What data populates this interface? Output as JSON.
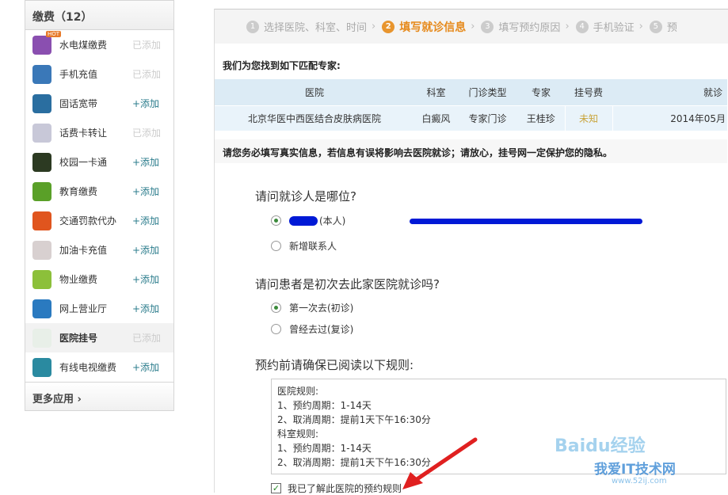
{
  "sidebar": {
    "title": "缴费（12）",
    "more": "更多应用",
    "hot": "HOT",
    "items": [
      {
        "label": "水电煤缴费",
        "action": "已添加",
        "added": true,
        "icon": "utilities-icon",
        "color": "#8a4fb0"
      },
      {
        "label": "手机充值",
        "action": "已添加",
        "added": true,
        "icon": "mobile-phone-icon",
        "color": "#3a78b8"
      },
      {
        "label": "固话宽带",
        "action": "+添加",
        "added": false,
        "icon": "landline-icon",
        "color": "#2a6ea0"
      },
      {
        "label": "话费卡转让",
        "action": "已添加",
        "added": true,
        "icon": "phone-card-icon",
        "color": "#c8c8d8"
      },
      {
        "label": "校园一卡通",
        "action": "+添加",
        "added": false,
        "icon": "campus-card-icon",
        "color": "#2c3a22"
      },
      {
        "label": "教育缴费",
        "action": "+添加",
        "added": false,
        "icon": "education-icon",
        "color": "#5aa028"
      },
      {
        "label": "交通罚款代办",
        "action": "+添加",
        "added": false,
        "icon": "traffic-fine-icon",
        "color": "#e0551e"
      },
      {
        "label": "加油卡充值",
        "action": "+添加",
        "added": false,
        "icon": "fuel-card-icon",
        "color": "#d8d0d0"
      },
      {
        "label": "物业缴费",
        "action": "+添加",
        "added": false,
        "icon": "property-icon",
        "color": "#8cc03a"
      },
      {
        "label": "网上营业厅",
        "action": "+添加",
        "added": false,
        "icon": "online-hall-icon",
        "color": "#2a7ac0"
      },
      {
        "label": "医院挂号",
        "action": "已添加",
        "added": true,
        "active": true,
        "icon": "hospital-icon",
        "color": "#e8efe8"
      },
      {
        "label": "有线电视缴费",
        "action": "+添加",
        "added": false,
        "icon": "tv-icon",
        "color": "#2a8aa0"
      }
    ]
  },
  "steps": [
    {
      "n": "1",
      "label": "选择医院、科室、时间"
    },
    {
      "n": "2",
      "label": "填写就诊信息"
    },
    {
      "n": "3",
      "label": "填写预约原因"
    },
    {
      "n": "4",
      "label": "手机验证"
    },
    {
      "n": "5",
      "label": "预"
    }
  ],
  "found_title": "我们为您找到如下匹配专家:",
  "table": {
    "headers": [
      "医院",
      "科室",
      "门诊类型",
      "专家",
      "挂号费",
      "就诊"
    ],
    "row": [
      "北京华医中西医结合皮肤病医院",
      "白癜风",
      "专家门诊",
      "王桂珍",
      "未知",
      "2014年05月"
    ]
  },
  "warning": "请您务必填写真实信息，若信息有误将影响去医院就诊；请放心，挂号网一定保护您的隐私。",
  "q1": {
    "title": "请问就诊人是哪位?",
    "opt1": "(本人)",
    "opt2": "新增联系人"
  },
  "q2": {
    "title": "请问患者是初次去此家医院就诊吗?",
    "opt1": "第一次去(初诊)",
    "opt2": "曾经去过(复诊)"
  },
  "q3": {
    "title": "预约前请确保已阅读以下规则:"
  },
  "rules": [
    "医院规则:",
    "1、预约周期：1-14天",
    "2、取消周期：提前1天下午16:30分",
    "科室规则:",
    "1、预约周期：1-14天",
    "2、取消周期：提前1天下午16:30分"
  ],
  "agree": "我已了解此医院的预约规则",
  "watermark": {
    "a": "Baidu经验",
    "b": "我爱IT技术网",
    "c": "www.52ij.com"
  }
}
